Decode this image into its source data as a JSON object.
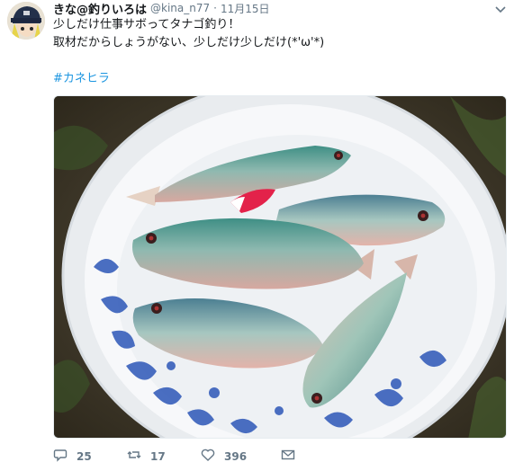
{
  "tweet": {
    "name": "きな@釣りいろは",
    "handle": "@kina_n77",
    "separator": "·",
    "date": "11月15日",
    "text_line1": "少しだけ仕事サボってタナゴ釣り！",
    "text_line2": "取材だからしょうがない、少しだけ少しだけ(*'ω'*)",
    "hashtag": "#カネヒラ"
  },
  "actions": {
    "replies": "25",
    "retweets": "17",
    "likes": "396"
  },
  "icons": {
    "reply": "reply-icon",
    "retweet": "retweet-icon",
    "like": "heart-icon",
    "dm": "envelope-icon",
    "menu": "chevron-down-icon"
  },
  "colors": {
    "link": "#1b95e0",
    "muted": "#657786",
    "text": "#14171a"
  }
}
